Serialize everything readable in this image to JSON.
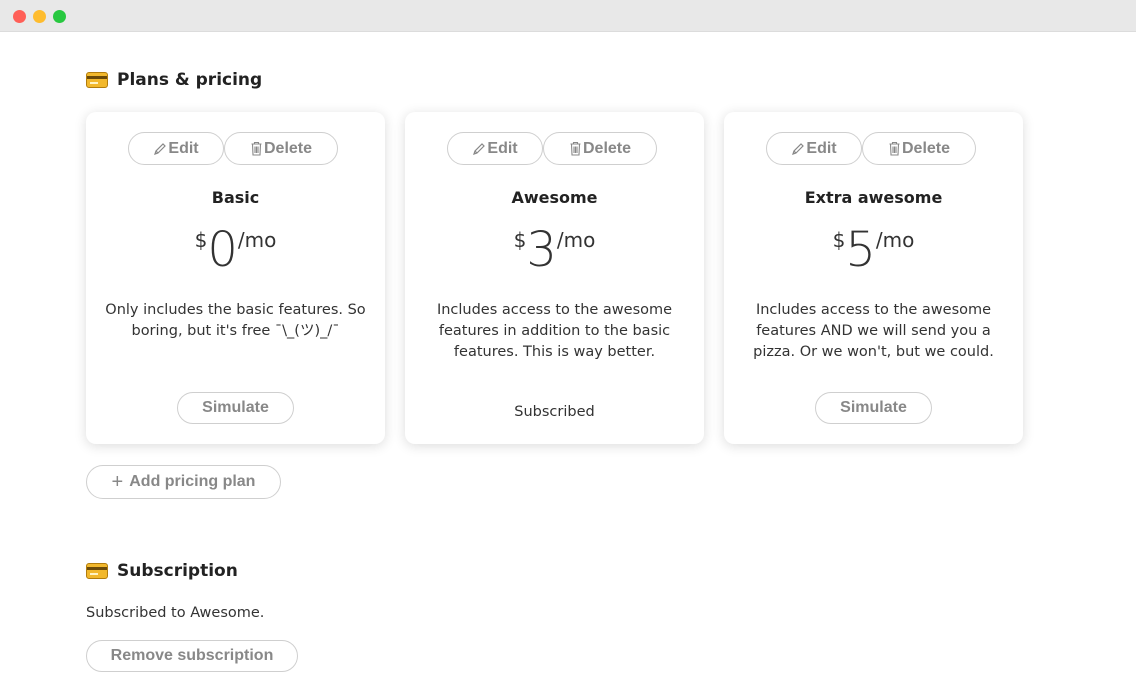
{
  "window": {
    "controls": [
      "close",
      "minimize",
      "maximize"
    ]
  },
  "plans_section": {
    "title": "Plans & pricing",
    "icon": "credit-card-icon"
  },
  "plans": [
    {
      "edit_label": "Edit",
      "delete_label": "Delete",
      "name": "Basic",
      "currency": "$",
      "amount": "0",
      "period": "/mo",
      "description": "Only includes the basic features. So boring, but it's free ¯\\_(ツ)_/¯",
      "simulate_label": "Simulate"
    },
    {
      "edit_label": "Edit",
      "delete_label": "Delete",
      "name": "Awesome",
      "currency": "$",
      "amount": "3",
      "period": "/mo",
      "description": "Includes access to the awesome features in addition to the basic features. This is way better.",
      "status": "Subscribed"
    },
    {
      "edit_label": "Edit",
      "delete_label": "Delete",
      "name": "Extra awesome",
      "currency": "$",
      "amount": "5",
      "period": "/mo",
      "description": "Includes access to the awesome features AND we will send you a pizza. Or we won't, but we could.",
      "simulate_label": "Simulate"
    }
  ],
  "add_plan_label": "Add pricing plan",
  "subscription_section": {
    "title": "Subscription",
    "icon": "credit-card-icon",
    "status_text": "Subscribed to Awesome.",
    "remove_label": "Remove subscription"
  },
  "colors": {
    "button_text": "#888888",
    "button_border": "#cfcfcf",
    "card_icon": "#f2b82c"
  }
}
